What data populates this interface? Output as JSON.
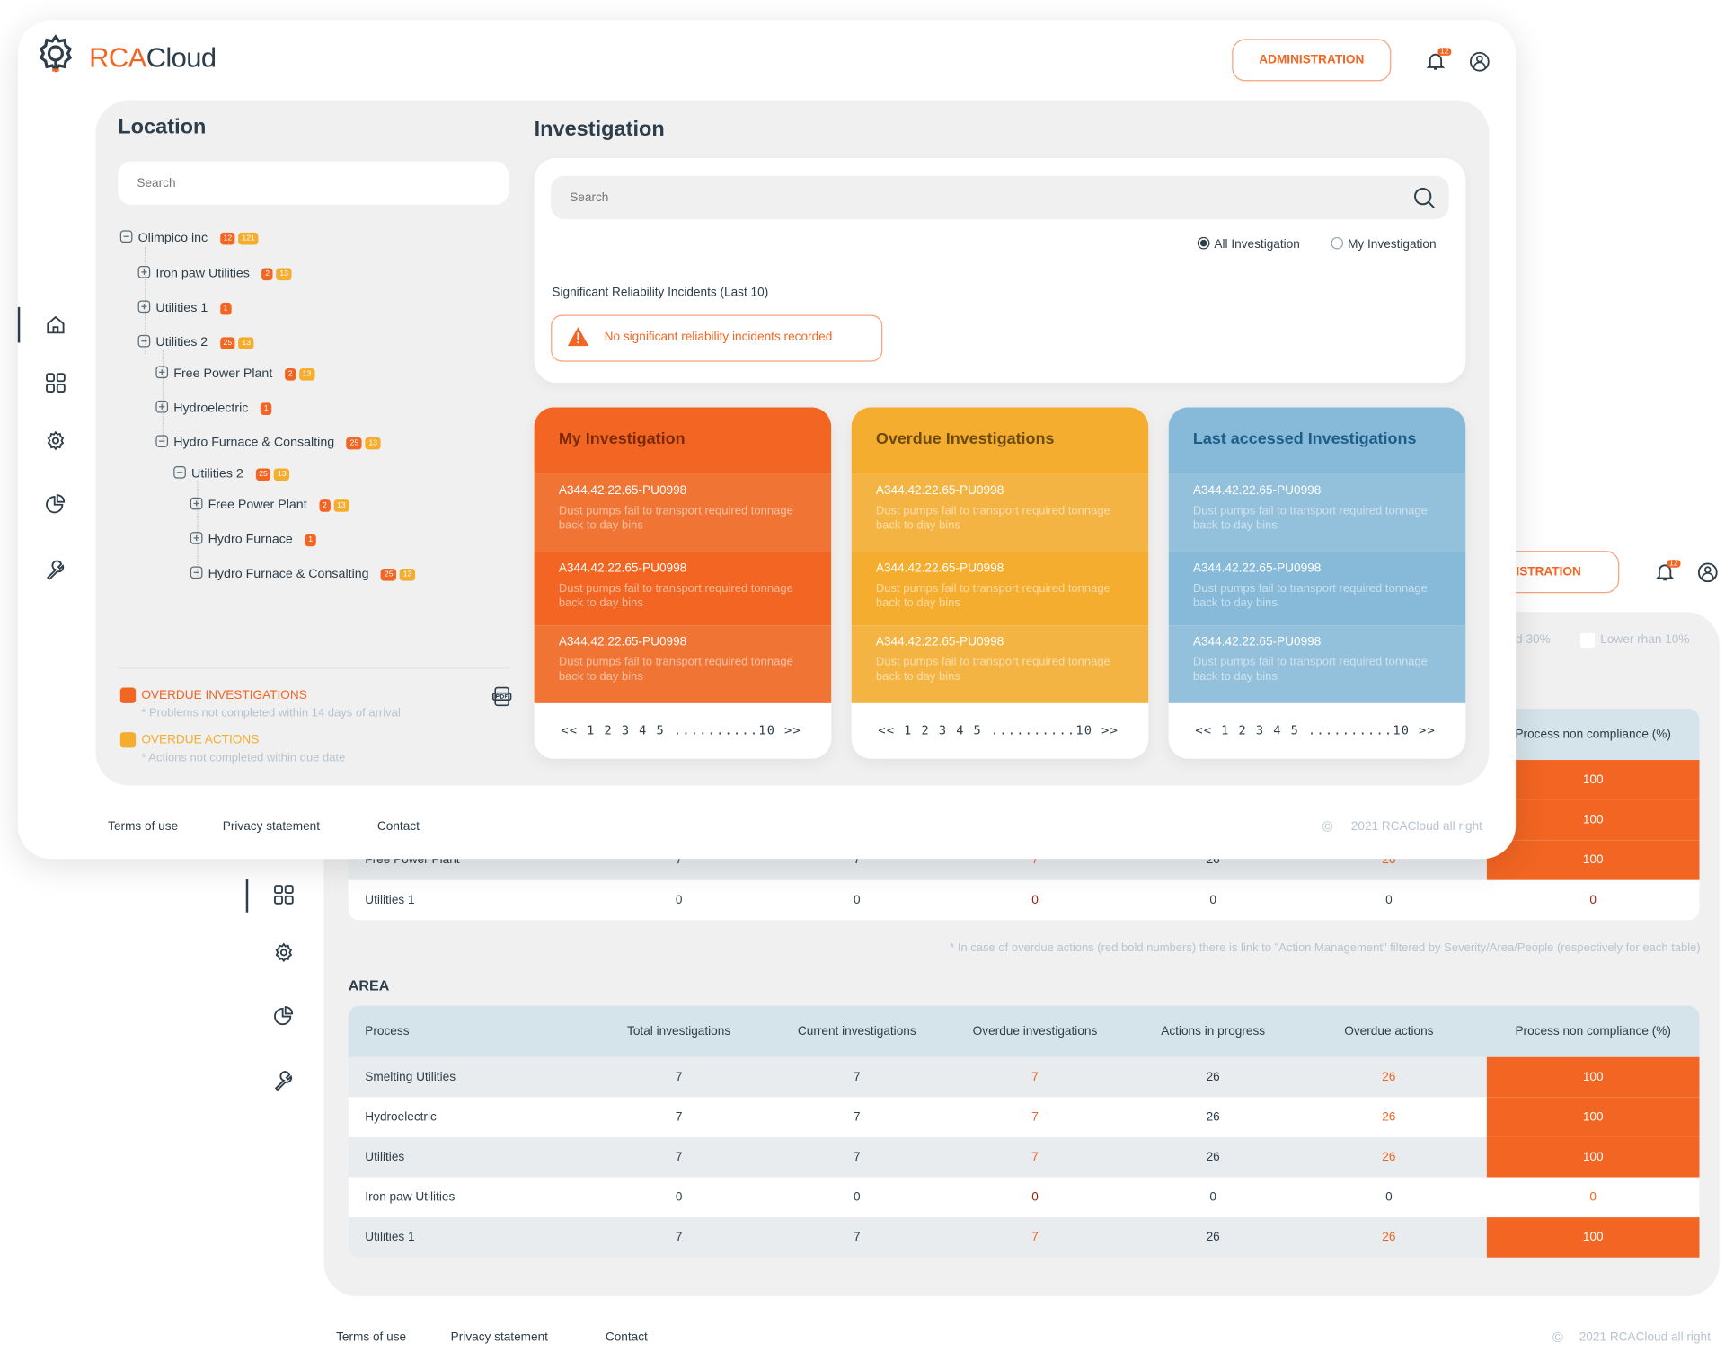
{
  "app": {
    "brand_prefix": "RCA",
    "brand_suffix": "Cloud",
    "admin_label": "ADMINISTRATION",
    "notif_count": "12"
  },
  "colors": {
    "accent": "#f26522",
    "yellow": "#f5ad30",
    "blue": "#86bad8",
    "dark": "#2d3e4a"
  },
  "sidebar": {
    "items": [
      {
        "icon": "home-icon",
        "active": true
      },
      {
        "icon": "grid-icon"
      },
      {
        "icon": "gear-icon"
      },
      {
        "icon": "pie-chart-icon"
      },
      {
        "icon": "wrench-icon"
      }
    ]
  },
  "location": {
    "title": "Location",
    "search_placeholder": "Search",
    "tree": [
      {
        "label": "Olimpico inc",
        "level": 0,
        "expanded": true,
        "badges": [
          "12",
          "121"
        ]
      },
      {
        "label": "Iron paw Utilities",
        "level": 1,
        "expanded": false,
        "badges": [
          "2",
          "13"
        ]
      },
      {
        "label": "Utilities 1",
        "level": 1,
        "expanded": false,
        "badges": [
          "1"
        ]
      },
      {
        "label": "Utilities 2",
        "level": 1,
        "expanded": true,
        "badges": [
          "25",
          "13"
        ]
      },
      {
        "label": "Free Power Plant",
        "level": 2,
        "expanded": false,
        "badges": [
          "2",
          "13"
        ]
      },
      {
        "label": "Hydroelectric",
        "level": 2,
        "expanded": false,
        "badges": [
          "1"
        ]
      },
      {
        "label": "Hydro Furnace & Consalting",
        "level": 2,
        "expanded": true,
        "badges": [
          "25",
          "13"
        ]
      },
      {
        "label": "Utilities 2",
        "level": 3,
        "expanded": true,
        "badges": [
          "25",
          "13"
        ]
      },
      {
        "label": "Free Power Plant",
        "level": 4,
        "expanded": false,
        "badges": [
          "2",
          "13"
        ]
      },
      {
        "label": "Hydro Furnace",
        "level": 4,
        "expanded": false,
        "badges": [
          "1"
        ]
      },
      {
        "label": "Hydro Furnace & Consalting",
        "level": 4,
        "expanded": true,
        "badges": [
          "25",
          "13"
        ]
      }
    ],
    "legend": [
      {
        "title": "OVERDUE INVESTIGATIONS",
        "note": "* Problems not completed within 14 days of arrival",
        "color": "#f26522"
      },
      {
        "title": "OVERDUE ACTIONS",
        "note": "* Actions not completed within due date",
        "color": "#f5ad30"
      }
    ]
  },
  "investigation": {
    "title": "Investigation",
    "search_placeholder": "Search",
    "radios": [
      {
        "label": "All Investigation",
        "checked": true
      },
      {
        "label": "My Investigation",
        "checked": false
      }
    ],
    "incidents_label": "Significant Reliability Incidents (Last 10)",
    "incidents_empty": "No significant reliability incidents recorded",
    "cards": [
      {
        "title": "My Investigation",
        "theme": "orange",
        "items": [
          {
            "id": "A344.42.22.65-PU0998",
            "desc": "Dust pumps fail to transport required tonnage back to day bins"
          },
          {
            "id": "A344.42.22.65-PU0998",
            "desc": "Dust pumps fail to transport required tonnage back to day bins"
          },
          {
            "id": "A344.42.22.65-PU0998",
            "desc": "Dust pumps fail to transport required tonnage back to day bins"
          }
        ]
      },
      {
        "title": "Overdue Investigations",
        "theme": "yellow",
        "items": [
          {
            "id": "A344.42.22.65-PU0998",
            "desc": "Dust pumps fail to transport required tonnage back to day bins"
          },
          {
            "id": "A344.42.22.65-PU0998",
            "desc": "Dust pumps fail to transport required tonnage back to day bins"
          },
          {
            "id": "A344.42.22.65-PU0998",
            "desc": "Dust pumps fail to transport required tonnage back to day bins"
          }
        ]
      },
      {
        "title": "Last accessed Investigations",
        "theme": "blue",
        "items": [
          {
            "id": "A344.42.22.65-PU0998",
            "desc": "Dust pumps fail to transport required tonnage back to day bins"
          },
          {
            "id": "A344.42.22.65-PU0998",
            "desc": "Dust pumps fail to transport required tonnage back to day bins"
          },
          {
            "id": "A344.42.22.65-PU0998",
            "desc": "Dust pumps fail to transport required tonnage back to day bins"
          }
        ]
      }
    ],
    "pager": [
      "<<",
      "1",
      "2",
      "3",
      "4",
      "5",
      "..........10",
      ">>"
    ]
  },
  "footer": {
    "links": [
      "Terms of use",
      "Privacy statement",
      "Contact"
    ],
    "copyright": "2021 RCACloud all right"
  },
  "background": {
    "admin_label_partial": "NISTRATION",
    "notif_count": "12",
    "legend": [
      {
        "label": "d 30%"
      },
      {
        "label": "Lower rhan 10%"
      }
    ],
    "top_table": {
      "nc_header": "Process non compliance (%)",
      "rows": [
        {
          "cells": [
            null,
            null,
            null,
            null,
            null,
            null,
            "100"
          ],
          "hl": true
        },
        {
          "cells": [
            null,
            null,
            null,
            null,
            null,
            null,
            "100"
          ],
          "hl": true
        },
        {
          "cells": [
            "Free Power Plant",
            "7",
            "7",
            "7",
            "26",
            "26",
            "100"
          ],
          "hl": true
        },
        {
          "cells": [
            "Utilities 1",
            "0",
            "0",
            "0",
            "0",
            "0",
            "0"
          ],
          "hl": false
        }
      ]
    },
    "note": "* In case of overdue actions (red bold numbers) there is link to \"Action Management\" filtered by Severity/Area/People (respectively for each table)",
    "area_title": "AREA",
    "area_table": {
      "headers": [
        "Process",
        "Total investigations",
        "Current investigations",
        "Overdue investigations",
        "Actions in  progress",
        "Overdue actions",
        "Process non compliance (%)"
      ],
      "rows": [
        {
          "cells": [
            "Smelting Utilities",
            "7",
            "7",
            "7",
            "26",
            "26",
            "100"
          ],
          "hl": true
        },
        {
          "cells": [
            "Hydroelectric",
            "7",
            "7",
            "7",
            "26",
            "26",
            "100"
          ],
          "hl": true
        },
        {
          "cells": [
            "Utilities",
            "7",
            "7",
            "7",
            "26",
            "26",
            "100"
          ],
          "hl": true
        },
        {
          "cells": [
            "Iron paw Utilities",
            "0",
            "0",
            "0",
            "0",
            "0",
            "0"
          ],
          "hl": false
        },
        {
          "cells": [
            "Utilities 1",
            "7",
            "7",
            "7",
            "26",
            "26",
            "100"
          ],
          "hl": true
        }
      ]
    }
  }
}
